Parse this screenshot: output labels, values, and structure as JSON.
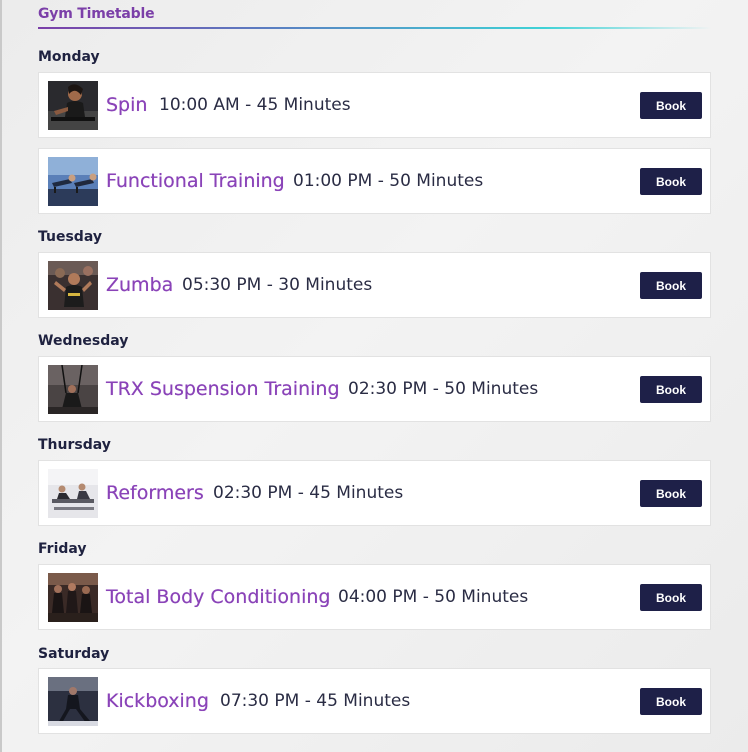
{
  "header": {
    "title": "Gym Timetable"
  },
  "schedule": [
    {
      "day": "Monday",
      "classes": [
        {
          "name": "Spin",
          "time": "10:00 AM - 45 Minutes",
          "book_label": "Book"
        },
        {
          "name": "Functional Training",
          "time": "01:00 PM - 50 Minutes",
          "book_label": "Book"
        }
      ]
    },
    {
      "day": "Tuesday",
      "classes": [
        {
          "name": "Zumba",
          "time": "05:30 PM - 30 Minutes",
          "book_label": "Book"
        }
      ]
    },
    {
      "day": "Wednesday",
      "classes": [
        {
          "name": "TRX Suspension Training",
          "time": "02:30 PM - 50 Minutes",
          "book_label": "Book"
        }
      ]
    },
    {
      "day": "Thursday",
      "classes": [
        {
          "name": "Reformers",
          "time": "02:30 PM - 45 Minutes",
          "book_label": "Book"
        }
      ]
    },
    {
      "day": "Friday",
      "classes": [
        {
          "name": "Total Body Conditioning",
          "time": "04:00 PM - 50 Minutes",
          "book_label": "Book"
        }
      ]
    },
    {
      "day": "Saturday",
      "classes": [
        {
          "name": "Kickboxing",
          "time": "07:30 PM - 45 Minutes",
          "book_label": "Book"
        }
      ]
    }
  ],
  "colors": {
    "accent_purple": "#8a43b8",
    "button_navy": "#1e2048",
    "header_gradient_end": "#3fd2d6"
  }
}
